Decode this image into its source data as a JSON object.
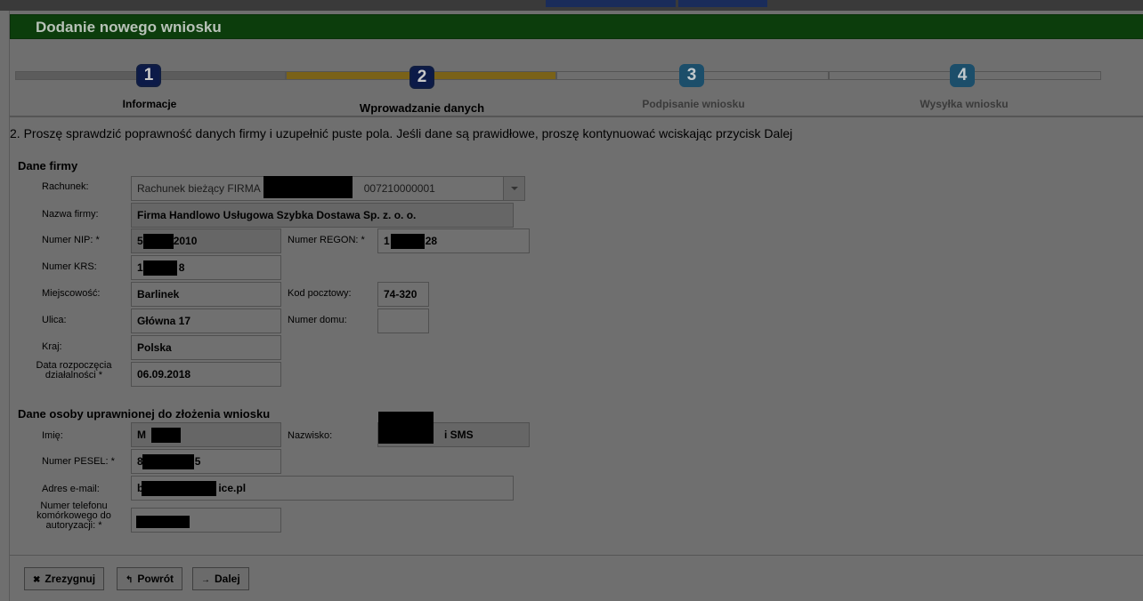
{
  "window": {
    "title": "Dodanie nowego wniosku"
  },
  "steps": [
    {
      "number": "1",
      "label": "Informacje"
    },
    {
      "number": "2",
      "label": "Wprowadzanie danych"
    },
    {
      "number": "3",
      "label": "Podpisanie wniosku"
    },
    {
      "number": "4",
      "label": "Wysyłka wniosku"
    }
  ],
  "intro": "2. Proszę sprawdzić poprawność danych firmy i uzupełnić puste pola. Jeśli dane są prawidłowe, proszę kontynuować wciskając przycisk Dalej",
  "company": {
    "heading": "Dane firmy",
    "account": {
      "label": "Rachunek:",
      "value_prefix": "Rachunek bieżący FIRMA",
      "value_suffix": "007210000001"
    },
    "name": {
      "label": "Nazwa firmy:",
      "value": "Firma Handlowo Usługowa Szybka Dostawa Sp. z. o. o."
    },
    "nip": {
      "label": "Numer NIP: *",
      "value_start": "5",
      "value_end": "2010"
    },
    "regon": {
      "label": "Numer REGON: *",
      "value_start": "1",
      "value_end": "28"
    },
    "krs": {
      "label": "Numer KRS:",
      "value_start": "1",
      "value_end": "8"
    },
    "city": {
      "label": "Miejscowość:",
      "value": "Barlinek"
    },
    "postal": {
      "label": "Kod pocztowy:",
      "value": "74-320"
    },
    "street": {
      "label": "Ulica:",
      "value": "Główna 17"
    },
    "house": {
      "label": "Numer domu:",
      "value": ""
    },
    "country": {
      "label": "Kraj:",
      "value": "Polska"
    },
    "start_date": {
      "label_line1": "Data rozpoczęcia",
      "label_line2": "działalności *",
      "value": "06.09.2018"
    }
  },
  "person": {
    "heading": "Dane osoby uprawnionej do złożenia wniosku",
    "first_name": {
      "label": "Imię:",
      "value_start": "M"
    },
    "last_name": {
      "label": "Nazwisko:",
      "value_end": "i SMS"
    },
    "pesel": {
      "label": "Numer PESEL: *",
      "value_start": "8",
      "value_end": "5"
    },
    "email": {
      "label": "Adres e-mail:",
      "value_start": "b",
      "value_end": "ice.pl"
    },
    "phone": {
      "label_line1": "Numer telefonu",
      "label_line2": "komórkowego do",
      "label_line3": "autoryzacji: *",
      "value": ""
    }
  },
  "buttons": {
    "cancel": {
      "icon": "✖",
      "label": "Zrezygnuj"
    },
    "back": {
      "icon": "↰",
      "label": "Powrót"
    },
    "next": {
      "icon": "→",
      "label": "Dalej"
    }
  },
  "colors": {
    "header_green": "#0c3d0c",
    "active_step": "#0c1a48",
    "progress_done": "#7a6218"
  }
}
